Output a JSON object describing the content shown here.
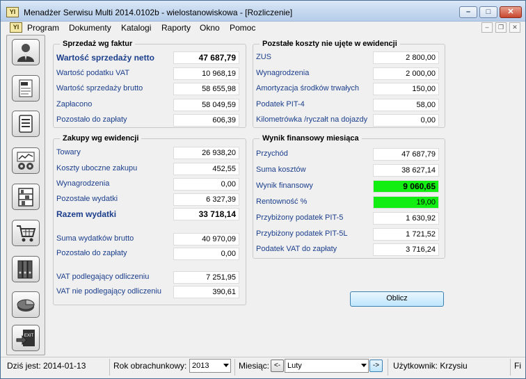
{
  "window": {
    "title": "Menadżer Serwisu Multi 2014.0102b - wielostanowiskowa - [Rozliczenie]",
    "icon_text": "YI",
    "controls": {
      "minimize": "–",
      "maximize": "□",
      "close": "✕"
    }
  },
  "menu": {
    "items": [
      "Program",
      "Dokumenty",
      "Katalogi",
      "Raporty",
      "Okno",
      "Pomoc"
    ],
    "mdi_controls": {
      "minimize": "–",
      "restore": "❐",
      "close": "✕"
    }
  },
  "sidebar": {
    "buttons": [
      "person-icon",
      "invoice-vat-icon",
      "document-list-icon",
      "chart-gears-icon",
      "shelves-icon",
      "shopping-cart-icon",
      "binders-icon",
      "pie-chart-icon",
      "exit-icon"
    ],
    "exit_label": "EXIT"
  },
  "sales": {
    "title": "Sprzedaż wg faktur",
    "rows": [
      {
        "label": "Wartość sprzedaży netto",
        "value": "47 687,79"
      },
      {
        "label": "Wartość podatku VAT",
        "value": "10 968,19"
      },
      {
        "label": "Wartość sprzedaży brutto",
        "value": "58 655,98"
      },
      {
        "label": "Zapłacono",
        "value": "58 049,59"
      },
      {
        "label": "Pozostało do zapłaty",
        "value": "606,39"
      }
    ]
  },
  "purchases": {
    "title": "Zakupy wg ewidencji",
    "rows": [
      {
        "label": "Towary",
        "value": "26 938,20"
      },
      {
        "label": "Koszty uboczne zakupu",
        "value": "452,55"
      },
      {
        "label": "Wynagrodzenia",
        "value": "0,00"
      },
      {
        "label": "Pozostałe wydatki",
        "value": "6 327,39"
      },
      {
        "label": "Razem wydatki",
        "value": "33 718,14"
      },
      {
        "label": "Suma wydatków brutto",
        "value": "40 970,09"
      },
      {
        "label": "Pozostało do zapłaty",
        "value": "0,00"
      },
      {
        "label": "VAT podlegający odliczeniu",
        "value": "7 251,95"
      },
      {
        "label": "VAT nie podlegający odliczeniu",
        "value": "390,61"
      }
    ]
  },
  "other_costs": {
    "title": "Pozstałe koszty nie ujęte w ewidencji",
    "rows": [
      {
        "label": "ZUS",
        "value": "2 800,00"
      },
      {
        "label": "Wynagrodzenia",
        "value": "2 000,00"
      },
      {
        "label": "Amortyzacja środków trwałych",
        "value": "150,00"
      },
      {
        "label": "Podatek PIT-4",
        "value": "58,00"
      },
      {
        "label": "Kilometrówka /ryczałt na dojazdy",
        "value": "0,00"
      }
    ]
  },
  "result": {
    "title": "Wynik finansowy miesiąca",
    "rows": [
      {
        "label": "Przychód",
        "value": "47 687,79"
      },
      {
        "label": "Suma kosztów",
        "value": "38 627,14"
      },
      {
        "label": "Wynik finansowy",
        "value": "9 060,65"
      },
      {
        "label": "Rentowność %",
        "value": "19,00"
      },
      {
        "label": "Przybiżony podatek PIT-5",
        "value": "1 630,92"
      },
      {
        "label": "Przybiżony podatek PIT-5L",
        "value": "1 721,52"
      },
      {
        "label": "Podatek VAT do zapłaty",
        "value": "3 716,24"
      }
    ],
    "highlight_color": "#12ee12"
  },
  "calculate_button": "Oblicz",
  "status": {
    "today": "Dziś jest: 2014-01-13",
    "year_label": "Rok obrachunkowy:",
    "year_value": "2013",
    "month_label": "Miesiąc:",
    "prev": "<-",
    "month_value": "Luty",
    "next": "->",
    "user": "Użytkownik: Krzysiu",
    "truncated": "Fi"
  }
}
